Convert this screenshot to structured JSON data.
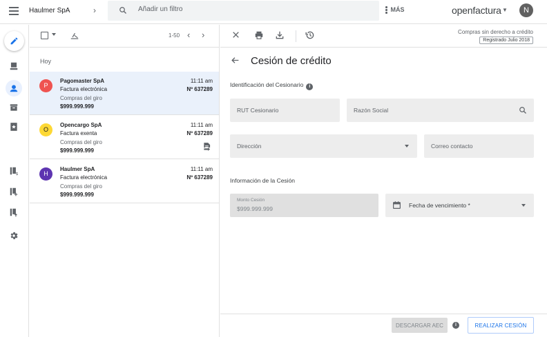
{
  "header": {
    "company": "Haulmer SpA",
    "search_placeholder": "Añadir un filtro",
    "more_label": "MÁS",
    "brand": "openfactura",
    "user_initial": "N"
  },
  "sidebar": {
    "icons": [
      "pencil-icon",
      "inbox-download-icon",
      "person-icon",
      "archive-icon",
      "star-doc-icon",
      "doc-dollar-icon",
      "doc-plus-icon",
      "doc-upload-icon",
      "gear-icon"
    ]
  },
  "list": {
    "range": "1-50",
    "day_label": "Hoy",
    "items": [
      {
        "initial": "P",
        "avatar_color": "#ef5350",
        "avatar_text_color": "#ffffff",
        "name": "Pagomaster SpA",
        "type": "Factura electrónica",
        "desc": "Compras del giro",
        "amount": "$999.999.999",
        "time": "11:11 am",
        "number": "Nº 637289",
        "selected": true
      },
      {
        "initial": "O",
        "avatar_color": "#fdd835",
        "avatar_text_color": "#202124",
        "name": "Opencargo SpA",
        "type": "Factura exenta",
        "desc": "Compras del giro",
        "amount": "$999.999.999",
        "time": "11:11 am",
        "number": "Nº 637289",
        "selected": false
      },
      {
        "initial": "H",
        "avatar_color": "#5e35b1",
        "avatar_text_color": "#ffffff",
        "name": "Haulmer SpA",
        "type": "Factura electrónica",
        "desc": "Compras del giro",
        "amount": "$999.999.999",
        "time": "11:11 am",
        "number": "Nº 637289",
        "selected": false
      }
    ]
  },
  "detail": {
    "note": "Compras sin derecho a crédito",
    "badge": "Registrado Julio 2018",
    "title": "Cesión de crédito",
    "section1": "Identificación del Cesionario",
    "rut_label": "RUT Cesionario",
    "razon_label": "Razón Social",
    "direccion_label": "Dirección",
    "correo_label": "Correo contacto",
    "section2": "Información de la Cesión",
    "monto_label": "Monto Cesión",
    "monto_value": "$999.999.999",
    "fecha_label": "Fecha de vencimiento *",
    "descargar_label": "DESCARGAR AEC",
    "realizar_label": "REALIZAR CESIÓN"
  }
}
